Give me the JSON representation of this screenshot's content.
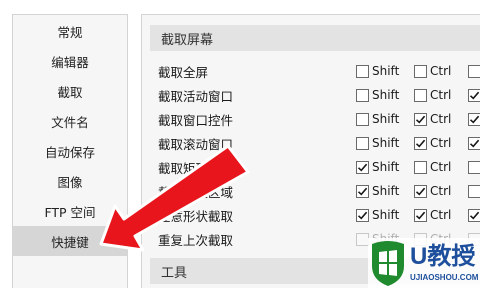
{
  "sidebar": {
    "items": [
      {
        "label": "常规",
        "active": false
      },
      {
        "label": "编辑器",
        "active": false
      },
      {
        "label": "截取",
        "active": false
      },
      {
        "label": "文件名",
        "active": false
      },
      {
        "label": "自动保存",
        "active": false
      },
      {
        "label": "图像",
        "active": false
      },
      {
        "label": "FTP 空间",
        "active": false
      },
      {
        "label": "快捷键",
        "active": true
      }
    ]
  },
  "main": {
    "section_capture_title": "截取屏幕",
    "section_tools_title": "工具",
    "modifier_labels": {
      "shift": "Shift",
      "ctrl": "Ctrl"
    },
    "rows": [
      {
        "label": "截取全屏",
        "shift": false,
        "ctrl": false,
        "alt": false
      },
      {
        "label": "截取活动窗口",
        "shift": false,
        "ctrl": false,
        "alt": true
      },
      {
        "label": "截取窗口控件",
        "shift": false,
        "ctrl": true,
        "alt": true
      },
      {
        "label": "截取滚动窗口",
        "shift": false,
        "ctrl": true,
        "alt": true
      },
      {
        "label": "截取矩形区域",
        "shift": true,
        "ctrl": false,
        "alt": false
      },
      {
        "label": "截取固定区域",
        "shift": true,
        "ctrl": true,
        "alt": false
      },
      {
        "label": "任意形状截取",
        "shift": true,
        "ctrl": true,
        "alt": true
      },
      {
        "label": "重复上次截取",
        "shift": false,
        "ctrl": false,
        "alt": false
      }
    ]
  },
  "watermark": {
    "brand": "U教授",
    "url": "UJIAOSHOU.COM"
  },
  "colors": {
    "arrow": "#e8161c",
    "watermark_green": "#1f8a2e",
    "watermark_blue": "#1d4f9c"
  }
}
